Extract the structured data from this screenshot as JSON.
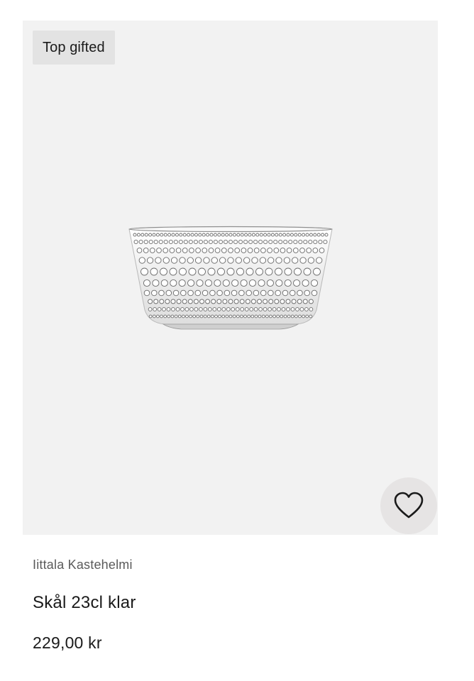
{
  "product": {
    "badge": "Top gifted",
    "brand": "Iittala Kastehelmi",
    "title": "Skål 23cl klar",
    "price": "229,00 kr",
    "image_alt": "glass-bowl",
    "wishlist_icon": "heart-icon"
  },
  "colors": {
    "image_background": "#f2f2f2",
    "badge_background": "#e3e3e3",
    "wishlist_background": "#e6e4e4",
    "text_primary": "#1a1a1a",
    "text_secondary": "#5a5a5a"
  }
}
